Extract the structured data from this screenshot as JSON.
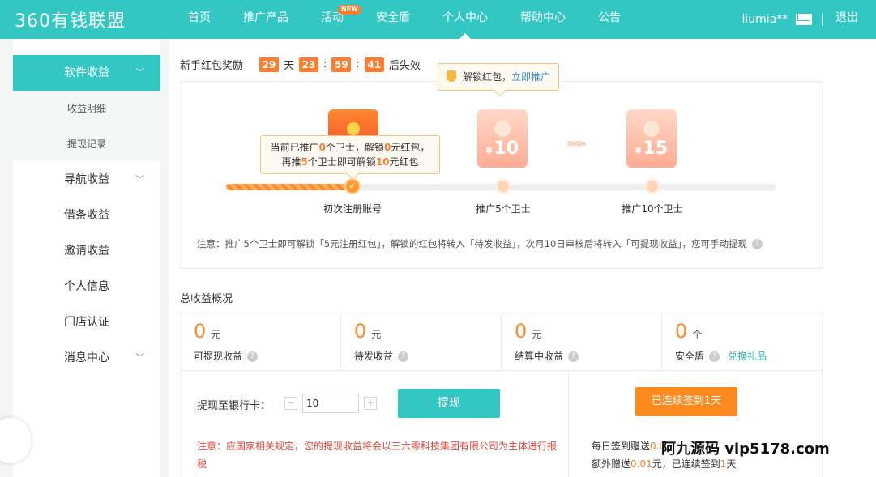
{
  "header": {
    "logo": "360有钱联盟",
    "nav": [
      "首页",
      "推广产品",
      "活动",
      "安全盾",
      "个人中心",
      "帮助中心",
      "公告"
    ],
    "new_badge": "NEW",
    "username": "liumia**",
    "separator": "|",
    "logout": "退出"
  },
  "sidebar": {
    "items": [
      {
        "label": "软件收益"
      },
      {
        "label": "收益明细"
      },
      {
        "label": "提现记录"
      },
      {
        "label": "导航收益"
      },
      {
        "label": "借条收益"
      },
      {
        "label": "邀请收益"
      },
      {
        "label": "个人信息"
      },
      {
        "label": "门店认证"
      },
      {
        "label": "消息中心"
      }
    ]
  },
  "newbie": {
    "title": "新手红包奖励",
    "countdown": {
      "d": "29",
      "d_label": "天",
      "h": "23",
      "m": "59",
      "s": "41",
      "sep": ":",
      "suffix": "后失效"
    },
    "tip_text": "解锁红包，",
    "tip_link": "立即推广",
    "bubble_line1_a": "当前已推广",
    "bubble_line1_b": "0",
    "bubble_line1_c": "个卫士，解锁",
    "bubble_line1_d": "0",
    "bubble_line1_e": "元红包，",
    "bubble_line2_a": "再推",
    "bubble_line2_b": "5",
    "bubble_line2_c": "个卫士即可解锁",
    "bubble_line2_d": "10",
    "bubble_line2_e": "元红包",
    "currency": "¥",
    "env1_amount": "10",
    "env2_amount": "15",
    "arrows": "»»»",
    "done_mark": "✓",
    "milestones": [
      "初次注册账号",
      "推广5个卫士",
      "推广10个卫士"
    ],
    "note": "注意：推广5个卫士即可解锁「5元注册红包」，解锁的红包将转入「待发收益」，次月10日审核后将转入「可提现收益」，您可手动提现",
    "progress": 0.2
  },
  "overview": {
    "title": "总收益概况",
    "stats": [
      {
        "value": "0",
        "unit": "元",
        "label": "可提现收益"
      },
      {
        "value": "0",
        "unit": "元",
        "label": "待发收益"
      },
      {
        "value": "0",
        "unit": "元",
        "label": "结算中收益"
      },
      {
        "value": "0",
        "unit": "个",
        "label": "安全盾",
        "link": "兑换礼品"
      }
    ],
    "help": "?"
  },
  "withdraw": {
    "label": "提现至银行卡：",
    "minus": "−",
    "plus": "+",
    "amount": "10",
    "button": "提现",
    "note": "注意：应国家相关规定，您的提现收益将会以三六零科技集团有限公司为主体进行报税"
  },
  "signin": {
    "button": "已连续签到1天",
    "line1_a": "每日签到赠送",
    "line1_b": "0.0",
    "line2_a": "额外赠送",
    "line2_b": "0.01",
    "line2_c": "元，已连续签到",
    "line2_d": "1",
    "line2_e": "天"
  },
  "watermark": "阿九源码 vip5178.com",
  "colors": {
    "primary": "#33c7c3",
    "accent": "#ff8a1e",
    "warning": "#e0463a"
  }
}
